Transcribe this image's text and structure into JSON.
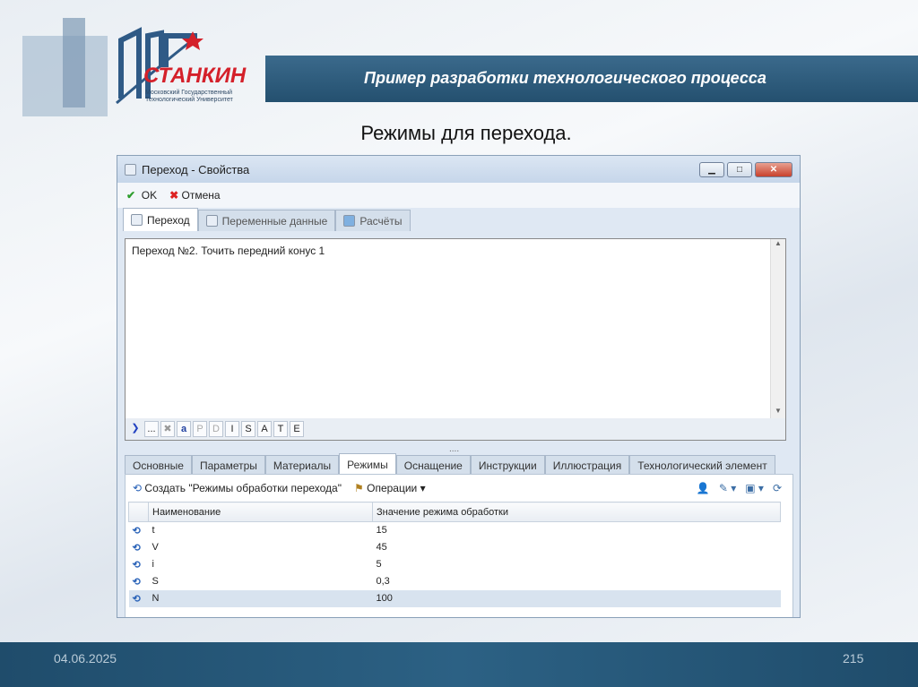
{
  "slide": {
    "title": "Пример разработки технологического процесса",
    "subtitle": "Режимы для перехода.",
    "date": "04.06.2025",
    "page": "215",
    "logo": {
      "name": "СТАНКИН",
      "line1": "Московский Государственный",
      "line2": "Технологический Университет"
    }
  },
  "window": {
    "title": "Переход - Свойства",
    "ok": "OK",
    "cancel": "Отмена",
    "tabs": [
      "Переход",
      "Переменные данные",
      "Расчёты"
    ],
    "text": "Переход №2. Точить передний конус 1",
    "format_buttons": [
      "...",
      "P",
      "D",
      "I",
      "S",
      "A",
      "T",
      "E"
    ],
    "splitter": "....",
    "tabs2": [
      "Основные",
      "Параметры",
      "Материалы",
      "Режимы",
      "Оснащение",
      "Инструкции",
      "Иллюстрация",
      "Технологический элемент"
    ],
    "create_label": "Создать \"Режимы обработки перехода\"",
    "operations_label": "Операции",
    "columns": [
      "Наименование",
      "Значение режима обработки"
    ],
    "rows": [
      {
        "name": "t",
        "value": "15"
      },
      {
        "name": "V",
        "value": "45"
      },
      {
        "name": "i",
        "value": "5"
      },
      {
        "name": "S",
        "value": "0,3"
      },
      {
        "name": "N",
        "value": "100"
      }
    ]
  }
}
